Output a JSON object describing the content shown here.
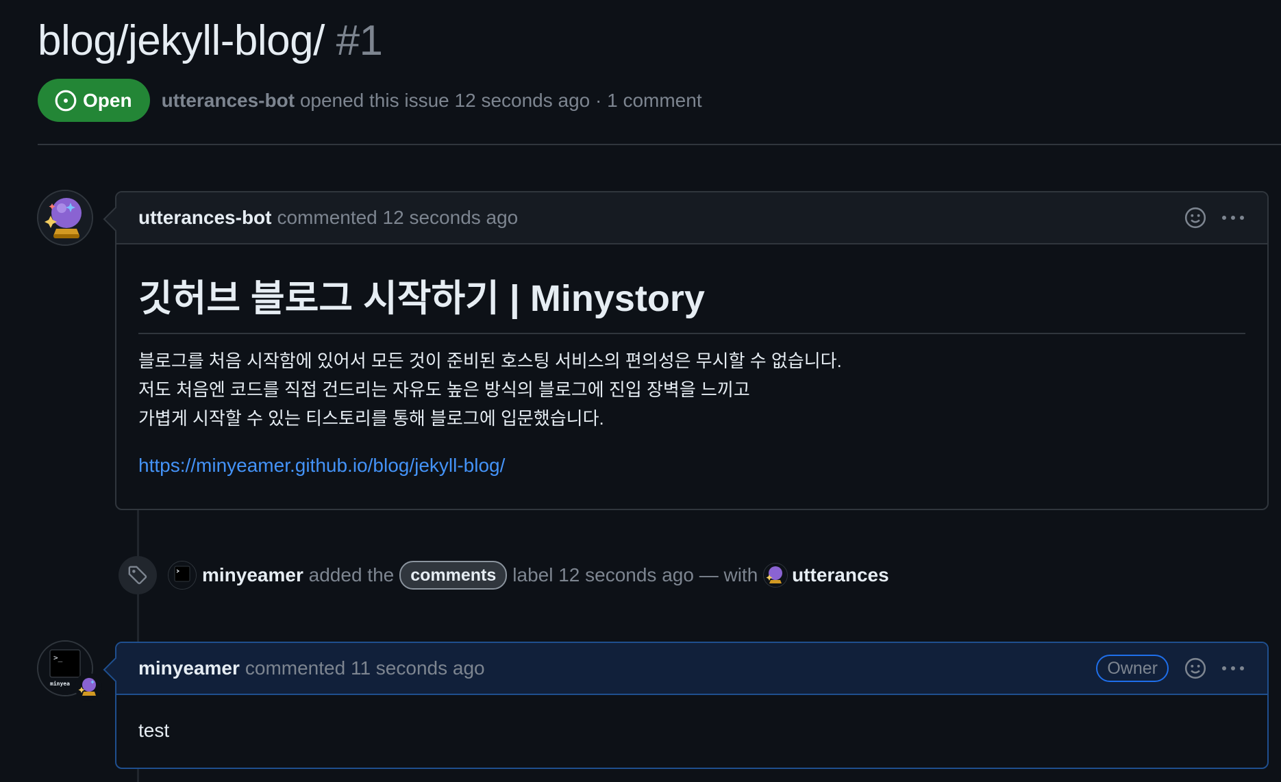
{
  "issue": {
    "title": "blog/jekyll-blog/",
    "number": "#1",
    "state": "Open",
    "author": "utterances-bot",
    "opened_text": "opened this issue 12 seconds ago · 1 comment"
  },
  "comments": [
    {
      "author": "utterances-bot",
      "action": "commented",
      "time": "12 seconds ago",
      "heading": "깃허브 블로그 시작하기 | Minystory",
      "lines": [
        "블로그를 처음 시작함에 있어서 모든 것이 준비된 호스팅 서비스의 편의성은 무시할 수 없습니다.",
        "저도 처음엔 코드를 직접 건드리는 자유도 높은 방식의 블로그에 진입 장벽을 느끼고",
        "가볍게 시작할 수 있는 티스토리를 통해 블로그에 입문했습니다."
      ],
      "link": "https://minyeamer.github.io/blog/jekyll-blog/"
    },
    {
      "author": "minyeamer",
      "action": "commented",
      "time": "11 seconds ago",
      "badge": "Owner",
      "body": "test"
    }
  ],
  "label_event": {
    "actor": "minyeamer",
    "text_before": "added the",
    "label": "comments",
    "text_after": "label 12 seconds ago — with",
    "app": "utterances"
  },
  "avatar_text": {
    "terminal": ">_",
    "minyea": "minyea"
  },
  "icons": {
    "state": "issue-opened-icon",
    "reaction": "smiley-icon",
    "menu": "kebab-horizontal-icon",
    "label_event": "tag-icon"
  },
  "colors": {
    "background": "#0d1117",
    "open_green": "#238636",
    "link": "#4493f8",
    "owner_border": "#1f6feb"
  }
}
